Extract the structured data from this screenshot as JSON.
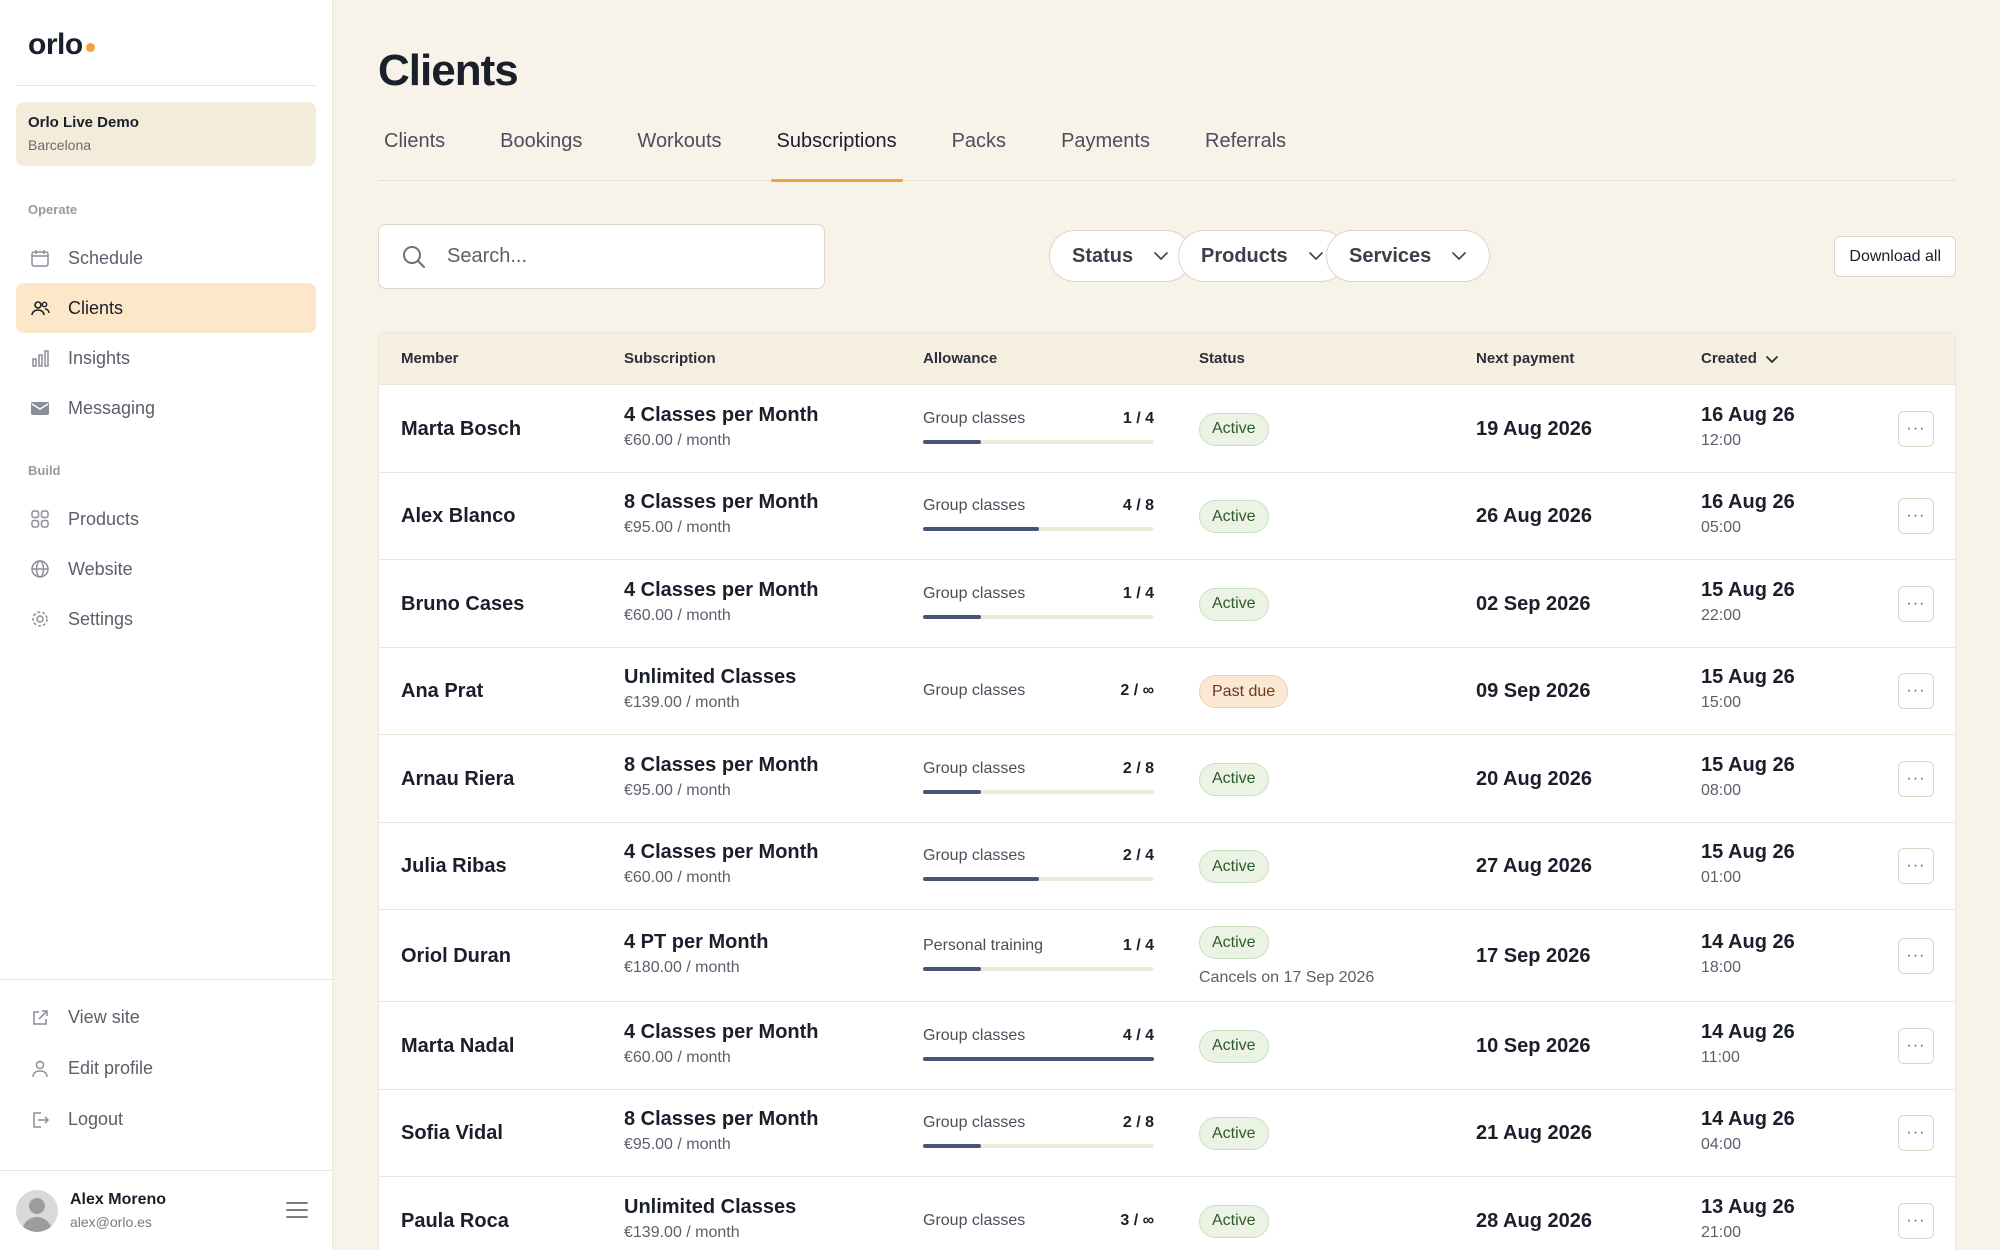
{
  "brand": {
    "logo": "orlo"
  },
  "org": {
    "name": "Orlo Live Demo",
    "city": "Barcelona"
  },
  "sidebar": {
    "operate_label": "Operate",
    "build_label": "Build",
    "operate_items": [
      {
        "label": "Schedule",
        "icon": "calendar-icon"
      },
      {
        "label": "Clients",
        "icon": "users-icon",
        "active": true
      },
      {
        "label": "Insights",
        "icon": "bar-chart-icon"
      },
      {
        "label": "Messaging",
        "icon": "envelope-icon"
      }
    ],
    "build_items": [
      {
        "label": "Products",
        "icon": "grid-icon"
      },
      {
        "label": "Website",
        "icon": "globe-icon"
      },
      {
        "label": "Settings",
        "icon": "gear-icon"
      }
    ],
    "bottom_items": [
      {
        "label": "View site",
        "icon": "external-link-icon"
      },
      {
        "label": "Edit profile",
        "icon": "user-icon"
      },
      {
        "label": "Logout",
        "icon": "logout-icon"
      }
    ]
  },
  "user": {
    "name": "Alex Moreno",
    "email": "alex@orlo.es"
  },
  "page": {
    "title": "Clients"
  },
  "tabs": [
    {
      "label": "Clients"
    },
    {
      "label": "Bookings"
    },
    {
      "label": "Workouts"
    },
    {
      "label": "Subscriptions",
      "active": true
    },
    {
      "label": "Packs"
    },
    {
      "label": "Payments"
    },
    {
      "label": "Referrals"
    }
  ],
  "toolbar": {
    "search_placeholder": "Search...",
    "filters": [
      "Status",
      "Products",
      "Services"
    ],
    "download_label": "Download all"
  },
  "table": {
    "headers": [
      "Member",
      "Subscription",
      "Allowance",
      "Status",
      "Next payment",
      "Created"
    ],
    "rows": [
      {
        "member": "Marta Bosch",
        "sub": "4 Classes per Month",
        "price": "€60.00 / month",
        "allow_label": "Group classes",
        "allow_count": "1 / 4",
        "fill": 0.25,
        "status": "Active",
        "status_type": "active",
        "next": "19 Aug 2026",
        "created_date": "16 Aug 26",
        "created_time": "12:00"
      },
      {
        "member": "Alex Blanco",
        "sub": "8 Classes per Month",
        "price": "€95.00 / month",
        "allow_label": "Group classes",
        "allow_count": "4 / 8",
        "fill": 0.5,
        "status": "Active",
        "status_type": "active",
        "next": "26 Aug 2026",
        "created_date": "16 Aug 26",
        "created_time": "05:00"
      },
      {
        "member": "Bruno Cases",
        "sub": "4 Classes per Month",
        "price": "€60.00 / month",
        "allow_label": "Group classes",
        "allow_count": "1 / 4",
        "fill": 0.25,
        "status": "Active",
        "status_type": "active",
        "next": "02 Sep 2026",
        "created_date": "15 Aug 26",
        "created_time": "22:00"
      },
      {
        "member": "Ana Prat",
        "sub": "Unlimited Classes",
        "price": "€139.00 / month",
        "allow_label": "Group classes",
        "allow_count": "2 / ∞",
        "fill": null,
        "status": "Past due",
        "status_type": "past",
        "next": "09 Sep 2026",
        "created_date": "15 Aug 26",
        "created_time": "15:00"
      },
      {
        "member": "Arnau Riera",
        "sub": "8 Classes per Month",
        "price": "€95.00 / month",
        "allow_label": "Group classes",
        "allow_count": "2 / 8",
        "fill": 0.25,
        "status": "Active",
        "status_type": "active",
        "next": "20 Aug 2026",
        "created_date": "15 Aug 26",
        "created_time": "08:00"
      },
      {
        "member": "Julia Ribas",
        "sub": "4 Classes per Month",
        "price": "€60.00 / month",
        "allow_label": "Group classes",
        "allow_count": "2 / 4",
        "fill": 0.5,
        "status": "Active",
        "status_type": "active",
        "next": "27 Aug 2026",
        "created_date": "15 Aug 26",
        "created_time": "01:00"
      },
      {
        "member": "Oriol Duran",
        "sub": "4 PT per Month",
        "price": "€180.00 / month",
        "allow_label": "Personal training",
        "allow_count": "1 / 4",
        "fill": 0.25,
        "status": "Active",
        "status_type": "active",
        "cancel_note": "Cancels on 17 Sep 2026",
        "next": "17 Sep 2026",
        "created_date": "14 Aug 26",
        "created_time": "18:00"
      },
      {
        "member": "Marta Nadal",
        "sub": "4 Classes per Month",
        "price": "€60.00 / month",
        "allow_label": "Group classes",
        "allow_count": "4 / 4",
        "fill": 1.0,
        "status": "Active",
        "status_type": "active",
        "next": "10 Sep 2026",
        "created_date": "14 Aug 26",
        "created_time": "11:00"
      },
      {
        "member": "Sofia Vidal",
        "sub": "8 Classes per Month",
        "price": "€95.00 / month",
        "allow_label": "Group classes",
        "allow_count": "2 / 8",
        "fill": 0.25,
        "status": "Active",
        "status_type": "active",
        "next": "21 Aug 2026",
        "created_date": "14 Aug 26",
        "created_time": "04:00"
      },
      {
        "member": "Paula Roca",
        "sub": "Unlimited Classes",
        "price": "€139.00 / month",
        "allow_label": "Group classes",
        "allow_count": "3 / ∞",
        "fill": null,
        "status": "Active",
        "status_type": "active",
        "next": "28 Aug 2026",
        "created_date": "13 Aug 26",
        "created_time": "21:00"
      }
    ],
    "more_label": "···"
  }
}
